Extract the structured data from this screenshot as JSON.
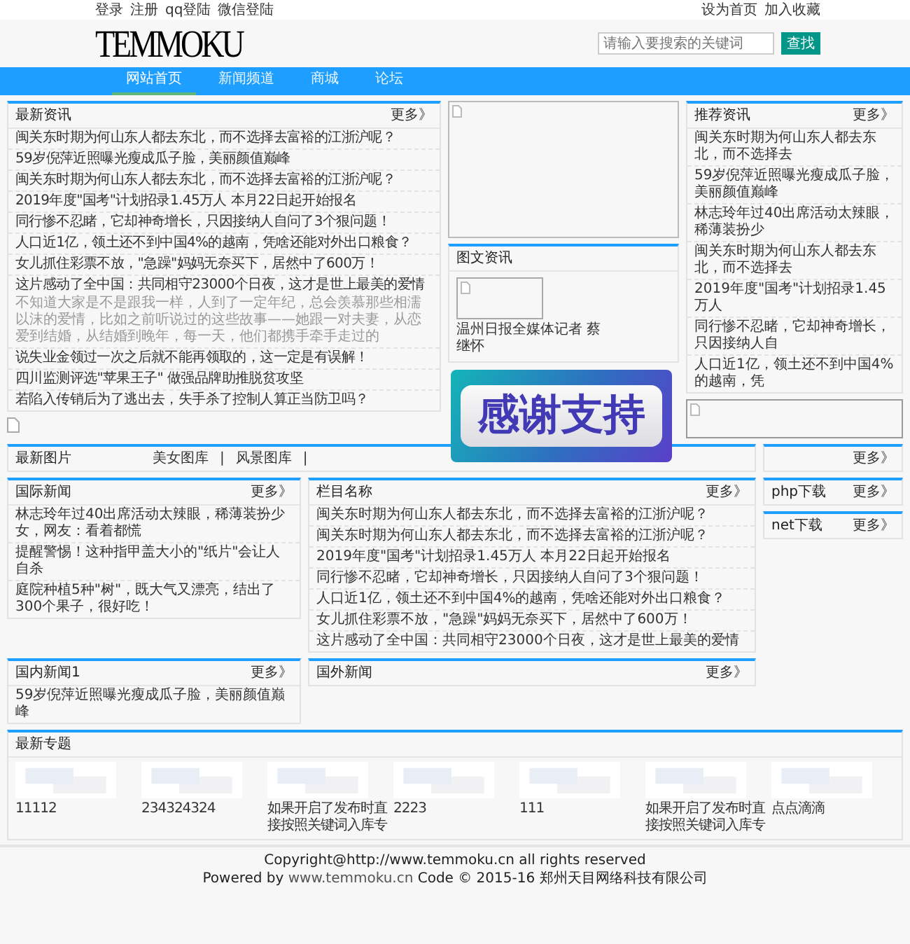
{
  "top_bar": {
    "left_links": [
      "登录",
      "注册",
      "qq登陆",
      "微信登陆"
    ],
    "right_links": [
      "设为首页",
      "加入收藏"
    ]
  },
  "header": {
    "logo": "TEMMOKU",
    "search": {
      "placeholder": "请输入要搜索的关键词",
      "button": "查找"
    }
  },
  "nav": [
    {
      "label": "网站首页",
      "selected": true
    },
    {
      "label": "新闻频道",
      "selected": false
    },
    {
      "label": "商城",
      "selected": false
    },
    {
      "label": "论坛",
      "selected": false
    }
  ],
  "latest_news": {
    "title": "最新资讯",
    "more": "更多》",
    "items": [
      {
        "title": "闽关东时期为何山东人都去东北，而不选择去富裕的江浙沪呢？"
      },
      {
        "title": "59岁倪萍近照曝光瘦成瓜子脸，美丽颜值巅峰"
      },
      {
        "title": "闽关东时期为何山东人都去东北，而不选择去富裕的江浙沪呢？"
      },
      {
        "title": "2019年度\"国考\"计划招录1.45万人 本月22日起开始报名"
      },
      {
        "title": "同行惨不忍睹，它却神奇增长，只因接纳人自问了3个狠问题！"
      },
      {
        "title": "人口近1亿，领土还不到中国4%的越南，凭啥还能对外出口粮食？"
      },
      {
        "title": "女儿抓住彩票不放，\"急躁\"妈妈无奈买下，居然中了600万！"
      },
      {
        "title": "这片感动了全中国：共同相守23000个日夜，这才是世上最美的爱情",
        "summary": "不知道大家是不是跟我一样，人到了一定年纪，总会羡慕那些相濡以沫的爱情，比如之前听说过的这些故事——她跟一对夫妻，从恋爱到结婚，从结婚到晚年，每一天，他们都携手牵手走过的"
      },
      {
        "title": "说失业金领过一次之后就不能再领取的，这一定是有误解！"
      },
      {
        "title": "四川监测评选\"苹果王子\" 做强品牌助推脱贫攻坚"
      },
      {
        "title": "若陷入传销后为了逃出去，失手杀了控制人算正当防卫吗？"
      }
    ]
  },
  "picture_news": {
    "title": "图文资讯",
    "items": [
      {
        "caption": "温州日报全媒体记者 蔡继怀"
      }
    ]
  },
  "recommended": {
    "title": "推荐资讯",
    "more": "更多》",
    "items": [
      "闽关东时期为何山东人都去东北，而不选择去",
      "59岁倪萍近照曝光瘦成瓜子脸，美丽颜值巅峰",
      "林志玲年过40出席活动太辣眼，稀薄装扮少",
      "闽关东时期为何山东人都去东北，而不选择去",
      "2019年度\"国考\"计划招录1.45万人",
      "同行惨不忍睹，它却神奇增长，只因接纳人自",
      "人口近1亿，领土还不到中国4%的越南，凭"
    ]
  },
  "banner": {
    "text": "感谢支持"
  },
  "latest_pictures": {
    "title": "最新图片",
    "links": [
      {
        "label": "美女图库",
        "separator": "|"
      },
      {
        "label": "风景图库",
        "separator": "|"
      }
    ]
  },
  "side_box": {
    "more": "更多》"
  },
  "international": {
    "title": "国际新闻",
    "more": "更多》",
    "items": [
      "林志玲年过40出席活动太辣眼，稀薄装扮少女，网友：看着都慌",
      "提醒警惕！这种指甲盖大小的\"纸片\"会让人自杀",
      "庭院种植5种\"树\"，既大气又漂亮，结出了300个果子，很好吃！"
    ]
  },
  "column": {
    "title": "栏目名称",
    "more": "更多》",
    "items": [
      "闽关东时期为何山东人都去东北，而不选择去富裕的江浙沪呢？",
      "闽关东时期为何山东人都去东北，而不选择去富裕的江浙沪呢？",
      "2019年度\"国考\"计划招录1.45万人 本月22日起开始报名",
      "同行惨不忍睹，它却神奇增长，只因接纳人自问了3个狠问题！",
      "人口近1亿，领土还不到中国4%的越南，凭啥还能对外出口粮食？",
      "女儿抓住彩票不放，\"急躁\"妈妈无奈买下，居然中了600万！",
      "这片感动了全中国：共同相守23000个日夜，这才是世上最美的爱情"
    ]
  },
  "downloads": [
    {
      "title": "php下载",
      "more": "更多》"
    },
    {
      "title": "net下载",
      "more": "更多》"
    }
  ],
  "domestic": {
    "title": "国内新闻1",
    "more": "更多》",
    "items": [
      "59岁倪萍近照曝光瘦成瓜子脸，美丽颜值巅峰"
    ]
  },
  "foreign": {
    "title": "国外新闻",
    "more": "更多》"
  },
  "topics": {
    "title": "最新专题",
    "items": [
      {
        "caption": "11112"
      },
      {
        "caption": "234324324"
      },
      {
        "caption": "如果开启了发布时直接按照关键词入库专"
      },
      {
        "caption": "2223"
      },
      {
        "caption": "111"
      },
      {
        "caption": "如果开启了发布时直接按照关键词入库专"
      },
      {
        "caption": "点点滴滴"
      }
    ]
  },
  "footer": {
    "copyright": "Copyright@http://www.temmoku.cn all rights reserved",
    "powered": {
      "before": "Powered by ",
      "link": "www.temmoku.cn",
      "after": " Code © 2015-16 郑州天目网络科技有限公司"
    }
  }
}
